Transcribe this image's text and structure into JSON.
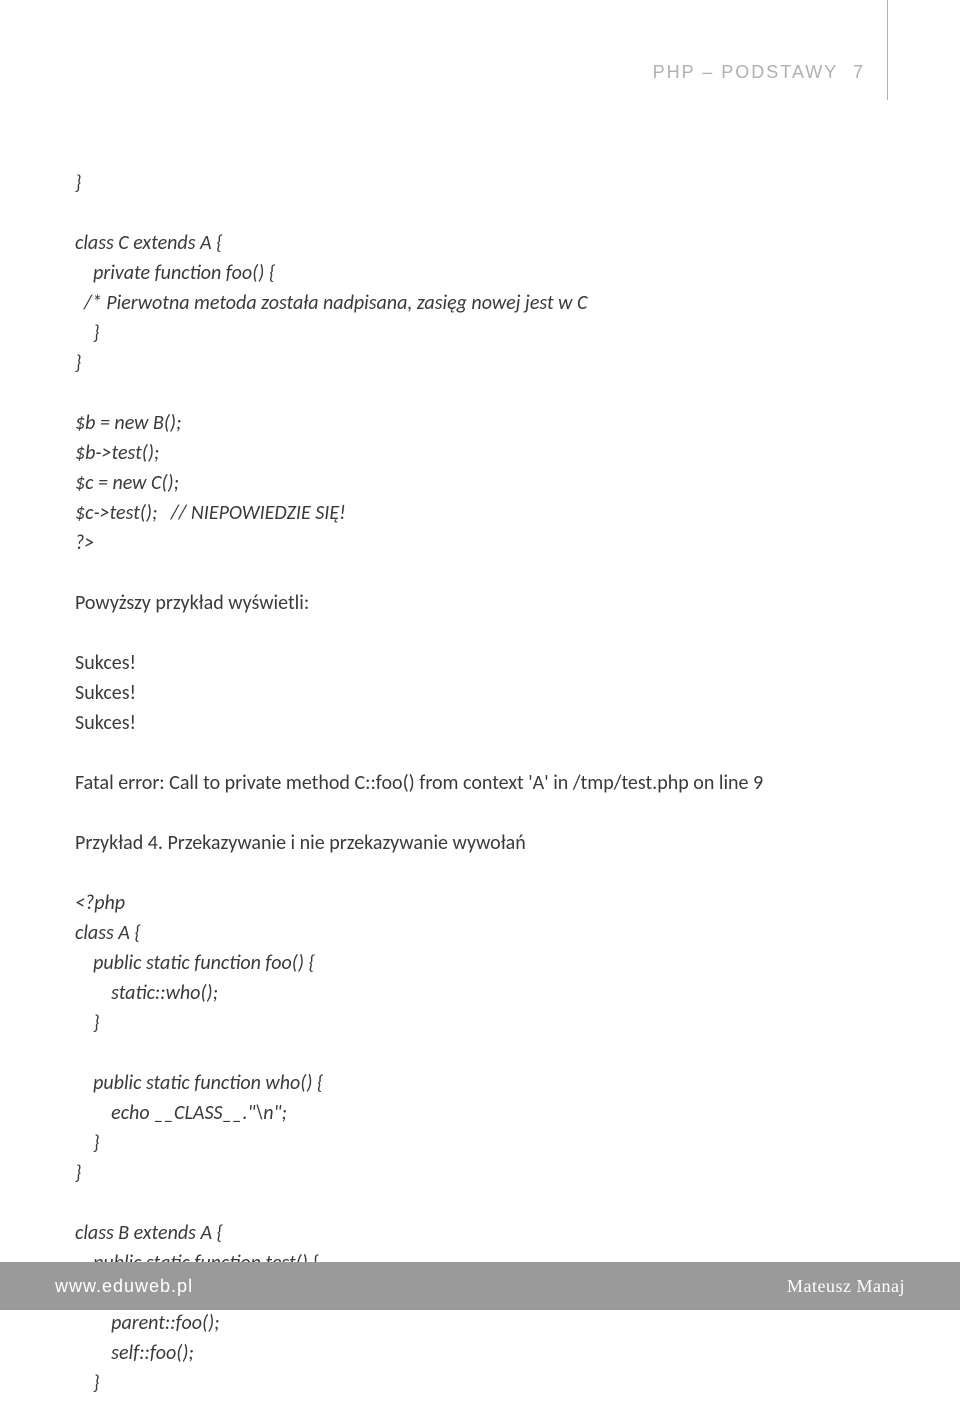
{
  "header": {
    "title": "PHP – PODSTAWY",
    "page_number": "7"
  },
  "body": {
    "code1": "}\n\nclass C extends A {\n    private function foo() {\n  /* Pierwotna metoda została nadpisana, zasięg nowej jest w C\n    }\n}\n\n$b = new B();\n$b->test();\n$c = new C();\n$c->test();   // NIEPOWIEDZIE SIĘ!\n?>",
    "para1": "Powyższy przykład wyświetli:",
    "output1": "Sukces!\nSukces!\nSukces!",
    "fatal": "Fatal error:  Call to private method C::foo() from context 'A' in /tmp/test.php on line 9",
    "para2": "Przykład 4. Przekazywanie i nie przekazywanie wywołań",
    "code2": "<?php\nclass A {\n    public static function foo() {\n        static::who();\n    }\n\n    public static function who() {\n        echo __CLASS__.\"\\n\";\n    }\n}\n\nclass B extends A {\n    public static function test() {\n        A::foo();\n        parent::foo();\n        self::foo();\n    }"
  },
  "footer": {
    "url": "www.eduweb.pl",
    "author": "Mateusz Manaj"
  }
}
